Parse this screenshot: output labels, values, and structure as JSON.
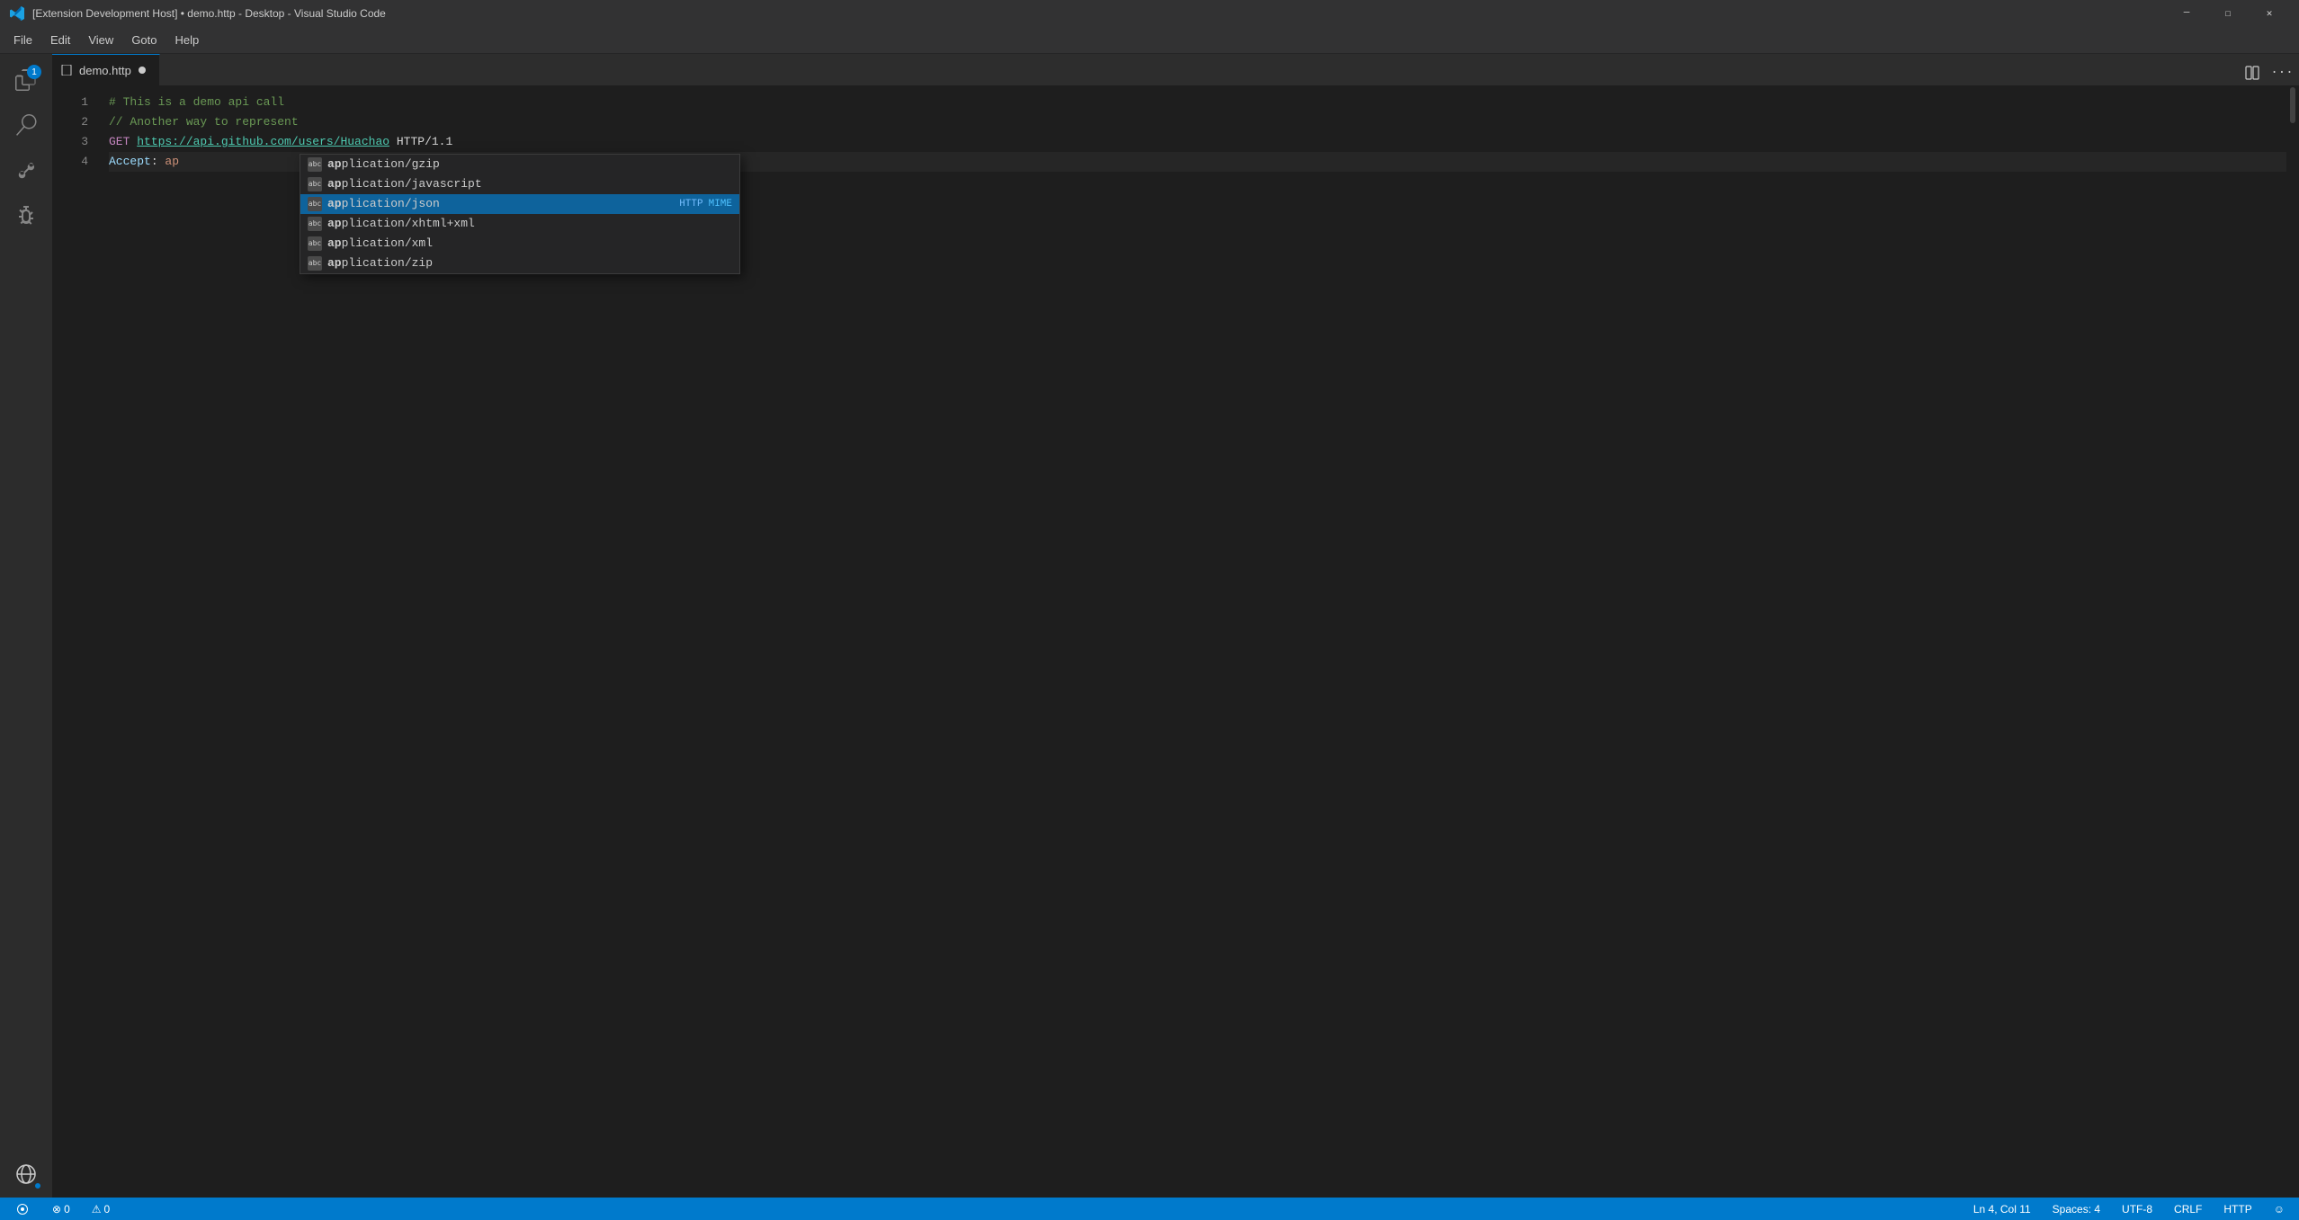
{
  "titlebar": {
    "title": "[Extension Development Host] • demo.http - Desktop - Visual Studio Code",
    "icon_label": "vscode-icon"
  },
  "menubar": {
    "items": [
      "File",
      "Edit",
      "View",
      "Goto",
      "Help"
    ]
  },
  "tab": {
    "filename": "demo.http",
    "modified": true
  },
  "editor": {
    "lines": [
      {
        "number": "1",
        "content": "# This is a demo api call",
        "type": "comment"
      },
      {
        "number": "2",
        "content": "// Another way to represent",
        "type": "comment"
      },
      {
        "number": "3",
        "content": "GET https://api.github.com/users/Huachao HTTP/1.1",
        "type": "request"
      },
      {
        "number": "4",
        "content": "Accept: ap",
        "type": "header"
      }
    ]
  },
  "autocomplete": {
    "items": [
      {
        "icon": "abc",
        "text": "application/gzip",
        "bold_end": 2,
        "label": ""
      },
      {
        "icon": "abc",
        "text": "application/javascript",
        "bold_end": 2,
        "label": ""
      },
      {
        "icon": "abc",
        "text": "application/json",
        "bold_end": 2,
        "label1": "HTTP",
        "label2": "MIME",
        "selected": true
      },
      {
        "icon": "abc",
        "text": "application/xhtml+xml",
        "bold_end": 2,
        "label": ""
      },
      {
        "icon": "abc",
        "text": "application/xml",
        "bold_end": 2,
        "label": ""
      },
      {
        "icon": "abc",
        "text": "application/zip",
        "bold_end": 2,
        "label": ""
      }
    ]
  },
  "statusbar": {
    "errors": "0",
    "warnings": "0",
    "position": "Ln 4, Col 11",
    "spaces": "Spaces: 4",
    "encoding": "UTF-8",
    "line_ending": "CRLF",
    "language": "HTTP",
    "feedback_icon": "smiley-icon"
  }
}
